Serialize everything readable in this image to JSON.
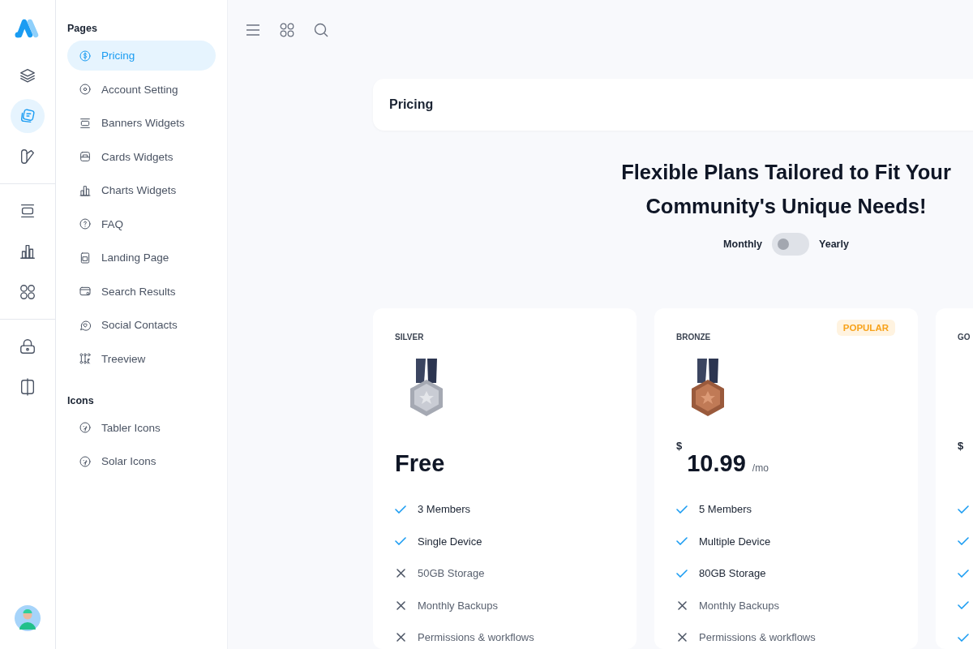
{
  "rail": {
    "items": [
      {
        "selected": false
      },
      {
        "selected": true
      },
      {
        "selected": false
      },
      {
        "selected": false
      },
      {
        "selected": false
      },
      {
        "selected": false
      },
      {
        "selected": false
      },
      {
        "selected": false
      }
    ]
  },
  "sidebar": {
    "sections": [
      {
        "title": "Pages",
        "items": [
          {
            "label": "Pricing",
            "selected": true
          },
          {
            "label": "Account Setting",
            "selected": false
          },
          {
            "label": "Banners Widgets",
            "selected": false
          },
          {
            "label": "Cards Widgets",
            "selected": false
          },
          {
            "label": "Charts Widgets",
            "selected": false
          },
          {
            "label": "FAQ",
            "selected": false
          },
          {
            "label": "Landing Page",
            "selected": false
          },
          {
            "label": "Search Results",
            "selected": false
          },
          {
            "label": "Social Contacts",
            "selected": false
          },
          {
            "label": "Treeview",
            "selected": false
          }
        ]
      },
      {
        "title": "Icons",
        "items": [
          {
            "label": "Tabler Icons",
            "selected": false
          },
          {
            "label": "Solar Icons",
            "selected": false
          }
        ]
      }
    ]
  },
  "page_header": {
    "title": "Pricing"
  },
  "headline": "Flexible Plans Tailored to Fit Your Community's Unique Needs!",
  "billing": {
    "left": "Monthly",
    "right": "Yearly",
    "on": false
  },
  "plans": [
    {
      "name": "SILVER",
      "price": "Free",
      "features": [
        {
          "text": "3 Members",
          "included": true
        },
        {
          "text": "Single Device",
          "included": true
        },
        {
          "text": "50GB Storage",
          "included": false
        },
        {
          "text": "Monthly Backups",
          "included": false
        },
        {
          "text": "Permissions & workflows",
          "included": false
        }
      ]
    },
    {
      "name": "BRONZE",
      "badge": "POPULAR",
      "currency": "$",
      "amount": "10.99",
      "period": "/mo",
      "features": [
        {
          "text": "5 Members",
          "included": true
        },
        {
          "text": "Multiple Device",
          "included": true
        },
        {
          "text": "80GB Storage",
          "included": true
        },
        {
          "text": "Monthly Backups",
          "included": false
        },
        {
          "text": "Permissions & workflows",
          "included": false
        }
      ]
    },
    {
      "name": "GO",
      "currency": "$",
      "features": [
        {
          "included": true
        },
        {
          "included": true
        },
        {
          "included": true
        },
        {
          "included": true
        },
        {
          "included": true
        }
      ]
    }
  ]
}
